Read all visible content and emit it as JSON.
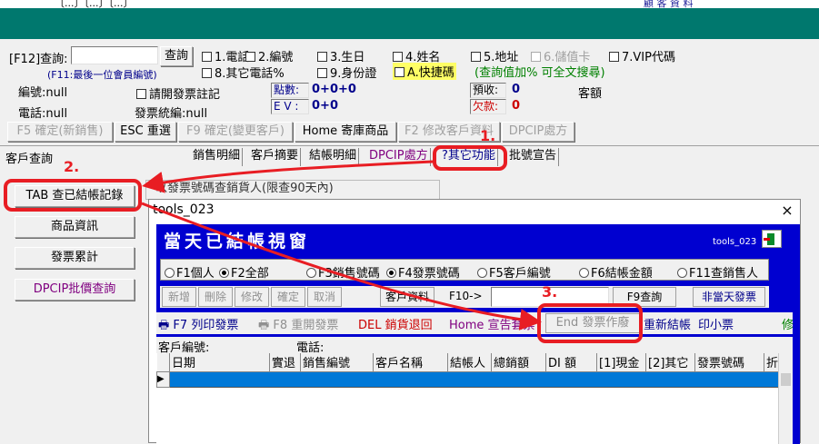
{
  "top_strip": {
    "left_text": "〔...〕〔...〕〔...〕",
    "right_text": "顧 客 資 料"
  },
  "search": {
    "label": "[F12]查詢:",
    "value": "",
    "button": "查詢",
    "hint": "(F11:最後一位會員編號)",
    "hint2": "(查詢值加% 可全文搜尋)"
  },
  "fields": [
    {
      "label": "1.電話",
      "checked": false
    },
    {
      "label": "2.編號",
      "checked": false
    },
    {
      "label": "3.生日",
      "checked": false
    },
    {
      "label": "4.姓名",
      "checked": false
    },
    {
      "label": "5.地址",
      "checked": false
    },
    {
      "label": "6.儲值卡",
      "checked": false,
      "disabled": true
    },
    {
      "label": "7.VIP代碼",
      "checked": false
    },
    {
      "label": "8.其它電話%",
      "checked": false
    },
    {
      "label": "9.身份證",
      "checked": false
    },
    {
      "label": "A.快捷碼",
      "checked": false
    }
  ],
  "info": {
    "id_label": "編號:null",
    "phone_label": "電話:null",
    "invoice_note_label": "請開發票註記",
    "invoice_code_label": "發票統編:null",
    "points_label": "點數:",
    "points_value": "0+0+0",
    "ev_label": "E V :",
    "ev_value": "0+0",
    "prepaid_label": "預收:",
    "prepaid_value": "0",
    "debt_label": "欠款:",
    "debt_value": "0",
    "amount_label": "客額"
  },
  "action_buttons": [
    {
      "label": "F5 確定(新銷售)",
      "disabled": true
    },
    {
      "label": "ESC 重選",
      "disabled": false
    },
    {
      "label": "F9 確定(變更客戶)",
      "disabled": true
    },
    {
      "label": "Home 寄庫商品",
      "disabled": false
    },
    {
      "label": "F2 修改客戶資料",
      "disabled": true
    },
    {
      "label": "DPCIP處方",
      "disabled": true
    }
  ],
  "section_title": "客戶查詢",
  "tabs": [
    "銷售明細",
    "客戶摘要",
    "結帳明細",
    "DPCIP處方",
    "?其它功能",
    "批號宣告"
  ],
  "left_buttons": [
    "TAB 查已結帳記錄",
    "商品資訊",
    "發票累計",
    "DPCIP批價查詢"
  ],
  "behind_text": "以發票號碼查銷貨人(限查90天內)",
  "annotations": [
    "1.",
    "2.",
    "3."
  ],
  "window": {
    "title": "tools_023",
    "close": "×",
    "heading": "當天已結帳視窗",
    "tag": "tools_023",
    "radios": [
      {
        "label": "F1個人",
        "on": false
      },
      {
        "label": "F2全部",
        "on": true
      },
      {
        "label": "F3銷售號碼",
        "on": false
      },
      {
        "label": "F4發票號碼",
        "on": true
      },
      {
        "label": "F5客戶編號",
        "on": false
      },
      {
        "label": "F6結帳金額",
        "on": false
      },
      {
        "label": "F11查銷售人",
        "on": false
      }
    ],
    "edit_buttons": [
      "新增",
      "刪除",
      "修改",
      "確定",
      "取消"
    ],
    "customer_btn": "客戶資料",
    "f10_label": "F10->",
    "f10_value": "",
    "f9_btn": "F9查詢",
    "not_today_btn": "非當天發票",
    "toolbar": [
      {
        "key": "F7",
        "label": "列印發票"
      },
      {
        "key": "F8",
        "label": "重開發票"
      },
      {
        "key": "DEL",
        "label": "銷貨退回"
      },
      {
        "key": "Home",
        "label": "宣告套票"
      },
      {
        "key": "End",
        "label": "發票作廢"
      },
      {
        "key": "",
        "label": "重新結帳"
      },
      {
        "key": "",
        "label": "印小票"
      },
      {
        "key": "",
        "label": "修"
      }
    ],
    "customer_no_label": "客戶編號:",
    "phone_label": "電話:",
    "columns": [
      "日期",
      "實退",
      "銷售編號",
      "客戶名稱",
      "結帳人",
      "總銷額",
      "DI 額",
      "[1]現金",
      "[2]其它",
      "發票號碼",
      "折"
    ]
  },
  "colors": {
    "teal": "#00786e",
    "blue_panel": "#0000d0",
    "annotation_red": "#e81d23"
  }
}
